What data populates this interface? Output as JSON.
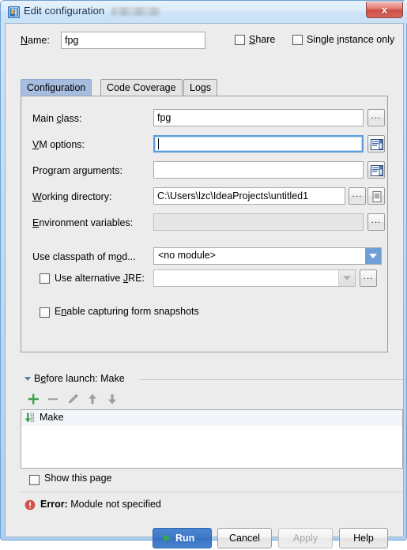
{
  "window": {
    "title": "Edit configuration",
    "app_icon": "intellij-idea-icon",
    "close_label": "x",
    "redacted_suffix": ""
  },
  "name_row": {
    "label": "Name:",
    "label_mnemonic": "N",
    "value": "fpg",
    "share": {
      "label": "Share",
      "mnemonic": "S",
      "checked": false
    },
    "single_instance": {
      "label": "Single instance only",
      "mnemonic": "i",
      "checked": false
    }
  },
  "tabs": [
    {
      "label": "Configuration",
      "active": true
    },
    {
      "label": "Code Coverage",
      "active": false
    },
    {
      "label": "Logs",
      "active": false
    }
  ],
  "fields": {
    "main_class": {
      "label": "Main class:",
      "mnemonic": "c",
      "value": "fpg",
      "placeholder": "",
      "browse_label": "...",
      "disabled": false,
      "focused": false
    },
    "vm_options": {
      "label": "VM options:",
      "mnemonic": "V",
      "value": "",
      "placeholder": "",
      "expand_icon": "expand-editor-icon",
      "disabled": false,
      "focused": true
    },
    "program_arguments": {
      "label": "Program arguments:",
      "mnemonic": "g",
      "value": "",
      "placeholder": "",
      "expand_icon": "expand-editor-icon",
      "disabled": false,
      "focused": false
    },
    "working_directory": {
      "label": "Working directory:",
      "mnemonic": "W",
      "value": "C:\\Users\\lzc\\IdeaProjects\\untitled1",
      "placeholder": "",
      "browse_label": "...",
      "macro_icon": "insert-macro-icon",
      "disabled": false,
      "focused": false
    },
    "environment_variables": {
      "label": "Environment variables:",
      "mnemonic": "E",
      "value": "",
      "placeholder": "",
      "browse_label": "...",
      "disabled": true,
      "focused": false
    },
    "classpath_module": {
      "label": "Use classpath of mod...",
      "mnemonic": "o",
      "value": "<no module>",
      "options": [
        "<no module>"
      ],
      "disabled": false
    },
    "alternative_jre": {
      "label": "Use alternative JRE:",
      "mnemonic": "J",
      "checked": false,
      "value": "",
      "placeholder": "",
      "browse_label": "...",
      "disabled": true
    },
    "form_snapshots": {
      "label": "Enable capturing form snapshots",
      "mnemonic": "n",
      "checked": false
    }
  },
  "before_launch": {
    "title": "Before launch: Make",
    "title_mnemonic": "e",
    "expanded": true,
    "toolbar": [
      {
        "name": "add-button",
        "glyph": "+",
        "enabled": true
      },
      {
        "name": "remove-button",
        "glyph": "−",
        "enabled": false
      },
      {
        "name": "edit-button",
        "glyph": "pencil-icon",
        "enabled": false
      },
      {
        "name": "move-up-button",
        "glyph": "arrow-up-icon",
        "enabled": false
      },
      {
        "name": "move-down-button",
        "glyph": "arrow-down-icon",
        "enabled": false
      }
    ],
    "items": [
      {
        "label": "Make",
        "icon": "make-task-icon",
        "selected": true
      }
    ]
  },
  "show_this_page": {
    "label": "Show this page",
    "checked": false
  },
  "error": {
    "icon": "error-icon",
    "prefix": "Error:",
    "message": "Module not specified"
  },
  "buttons": [
    {
      "label": "Run",
      "style": "primary",
      "icon": "play-icon",
      "enabled": true
    },
    {
      "label": "Cancel",
      "style": "normal",
      "enabled": true
    },
    {
      "label": "Apply",
      "style": "disabled",
      "enabled": false
    },
    {
      "label": "Help",
      "style": "normal",
      "enabled": true
    }
  ],
  "colors": {
    "accent_blue": "#3d77c6",
    "tab_active": "#a7bddf",
    "combo_arrow": "#6f9fd8",
    "error_red": "#d4514a",
    "add_green": "#3aa34a",
    "play_green": "#32a852",
    "titlebar_top": "#e8f2fb",
    "panel_bg": "#ececec"
  }
}
